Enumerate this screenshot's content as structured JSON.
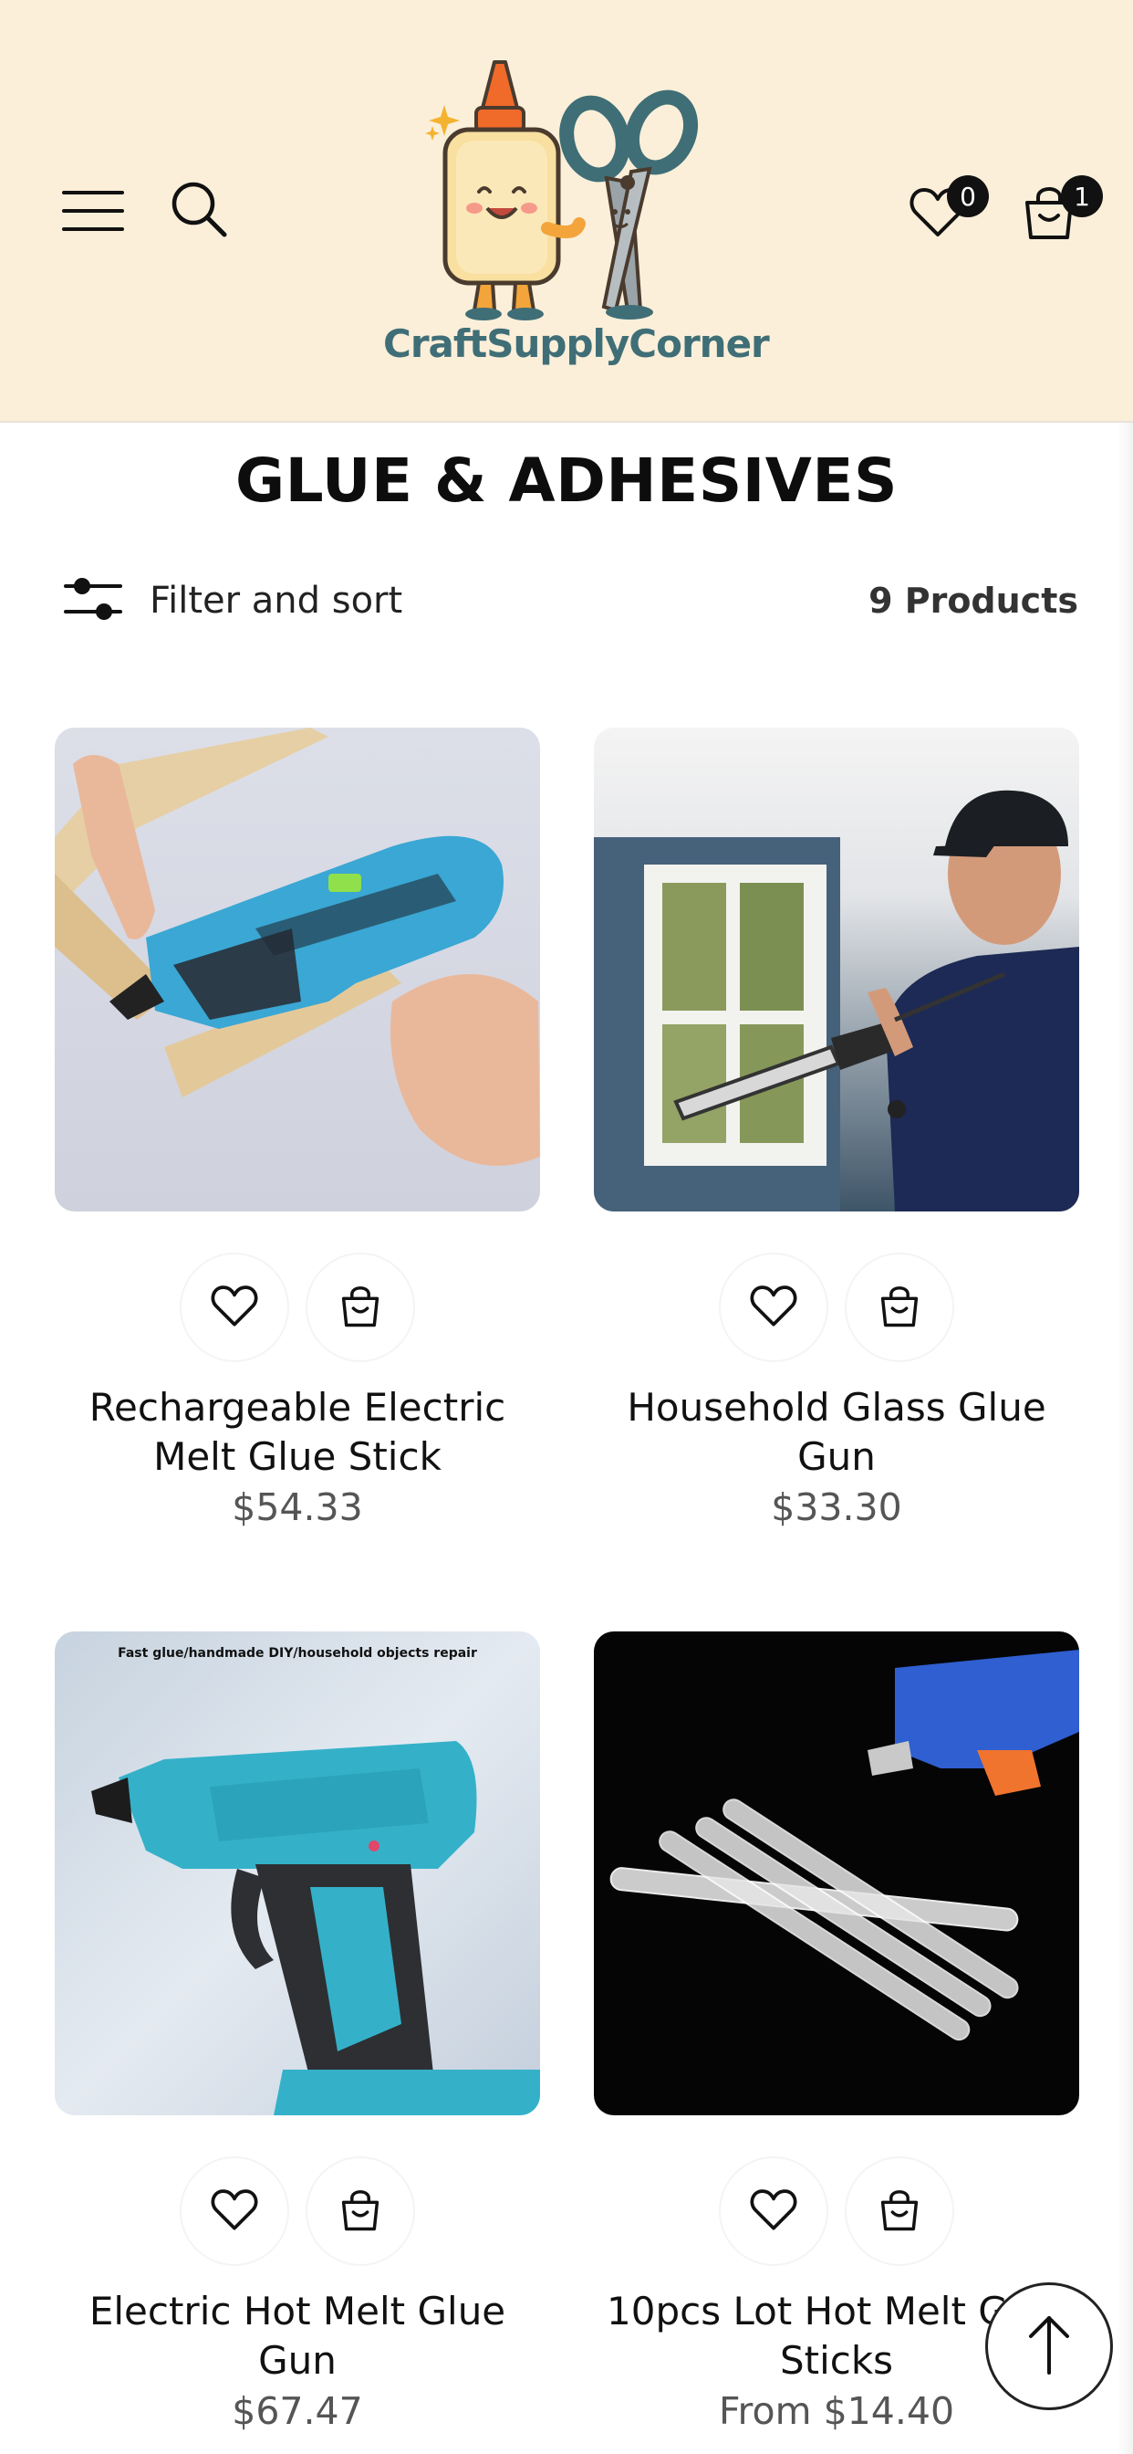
{
  "brand": {
    "name": "CraftSupplyCorner"
  },
  "header": {
    "wishlist_count": "0",
    "cart_count": "1"
  },
  "collection": {
    "title": "GLUE & ADHESIVES",
    "filter_label": "Filter and sort",
    "product_count": "9 Products"
  },
  "products": [
    {
      "title": "Rechargeable Electric Melt Glue Stick",
      "price": "$54.33",
      "image_icon": "blue-cordless-glue-gun-photo"
    },
    {
      "title": "Household Glass Glue Gun",
      "price": "$33.30",
      "image_icon": "caulking-gun-man-window-photo"
    },
    {
      "title": "Electric Hot Melt Glue Gun",
      "price": "$67.47",
      "image_icon": "teal-glue-gun-photo",
      "image_caption": "Fast glue/handmade DIY/household objects repair"
    },
    {
      "title": "10pcs Lot Hot Melt Glue Sticks",
      "price": "From $14.40",
      "image_icon": "glue-sticks-on-black-photo"
    }
  ],
  "colors": {
    "header_bg": "#fbefd9",
    "logo_text": "#3f6e77",
    "accent_dark": "#111111"
  }
}
